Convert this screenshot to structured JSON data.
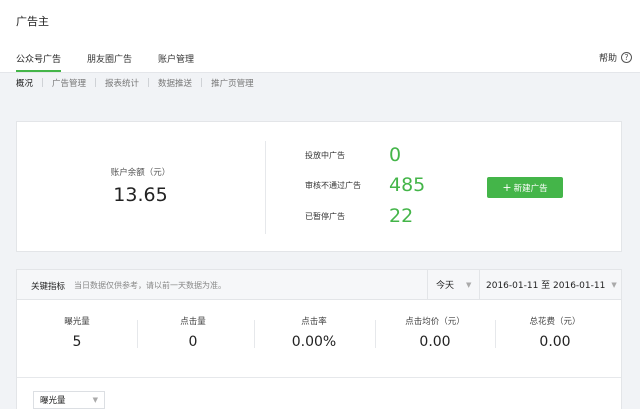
{
  "app": {
    "title": "广告主"
  },
  "tabs": [
    {
      "label": "公众号广告",
      "active": true
    },
    {
      "label": "朋友圈广告",
      "active": false
    },
    {
      "label": "账户管理",
      "active": false
    }
  ],
  "help": {
    "label": "帮助",
    "icon": "question-mark-icon",
    "glyph": "?"
  },
  "subnav": [
    {
      "label": "概况",
      "active": true
    },
    {
      "label": "广告管理",
      "active": false
    },
    {
      "label": "报表统计",
      "active": false
    },
    {
      "label": "数据推送",
      "active": false
    },
    {
      "label": "推广页管理",
      "active": false
    }
  ],
  "overview": {
    "balance_label": "账户余额（元）",
    "balance_value": "13.65",
    "stats": [
      {
        "label": "投放中广告",
        "value": "0"
      },
      {
        "label": "审核不通过广告",
        "value": "485"
      },
      {
        "label": "已暂停广告",
        "value": "22"
      }
    ],
    "new_ad_button": {
      "label": "新建广告",
      "icon": "plus-icon",
      "glyph": "+"
    }
  },
  "metrics": {
    "title": "关键指标",
    "note": "当日数据仅供参考，请以前一天数据为准。",
    "period": "今天",
    "date_range": "2016-01-11 至 2016-01-11",
    "items": [
      {
        "label": "曝光量",
        "value": "5"
      },
      {
        "label": "点击量",
        "value": "0"
      },
      {
        "label": "点击率",
        "value": "0.00%"
      },
      {
        "label": "点击均价（元）",
        "value": "0.00"
      },
      {
        "label": "总花费（元）",
        "value": "0.00"
      }
    ],
    "series_select": "曝光量"
  },
  "colors": {
    "accent": "#44b549",
    "background": "#f1f3f6"
  }
}
